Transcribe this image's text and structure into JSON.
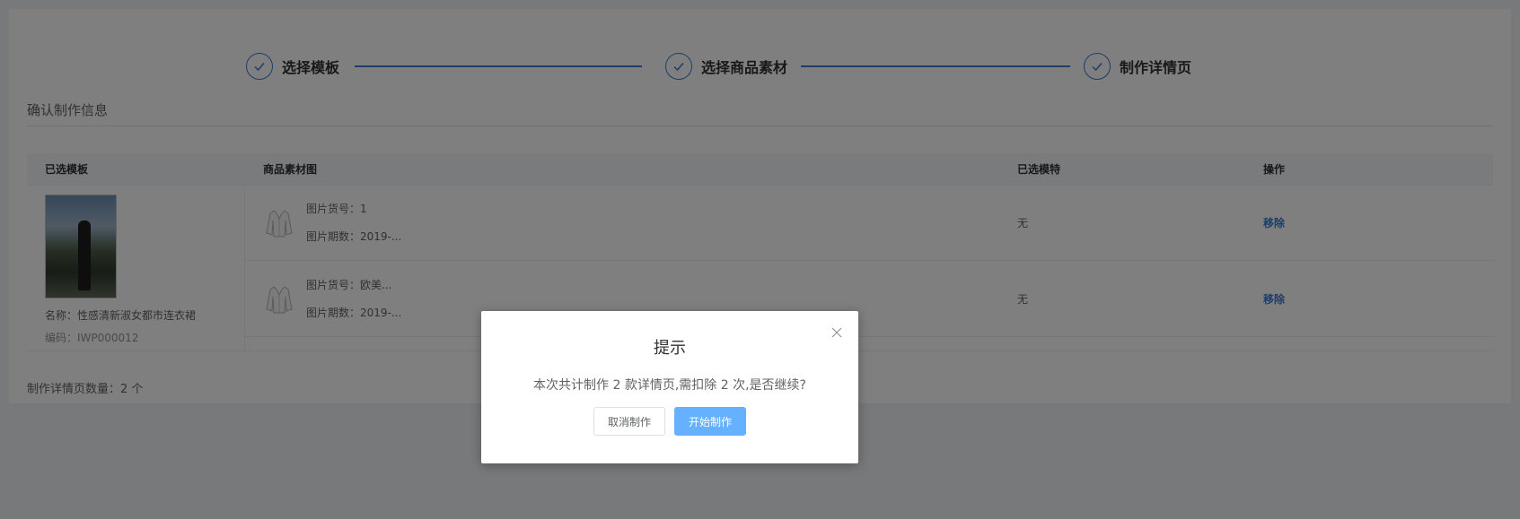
{
  "steps": [
    {
      "title": "选择模板"
    },
    {
      "title": "选择商品素材"
    },
    {
      "title": "制作详情页"
    }
  ],
  "section": {
    "title": "确认制作信息"
  },
  "table": {
    "headers": {
      "template": "已选模板",
      "material": "商品素材图",
      "model": "已选模特",
      "operation": "操作"
    },
    "template": {
      "name": "名称：性感清新淑女都市连衣裙",
      "code": "编码：IWP000012"
    },
    "rows": [
      {
        "item_no": "图片货号：1",
        "period": "图片期数：2019-...",
        "model": "无",
        "action": "移除"
      },
      {
        "item_no": "图片货号：欧美...",
        "period": "图片期数：2019-...",
        "model": "无",
        "action": "移除"
      }
    ]
  },
  "footer": {
    "count_text": "制作详情页数量：2 个"
  },
  "dialog": {
    "title": "提示",
    "message": "本次共计制作 2 款详情页,需扣除 2 次,是否继续?",
    "cancel_label": "取消制作",
    "confirm_label": "开始制作"
  },
  "colors": {
    "accent": "#3a7bd5",
    "primary_button": "#66b1ff",
    "mask": "rgba(0,0,0,0.5)"
  }
}
